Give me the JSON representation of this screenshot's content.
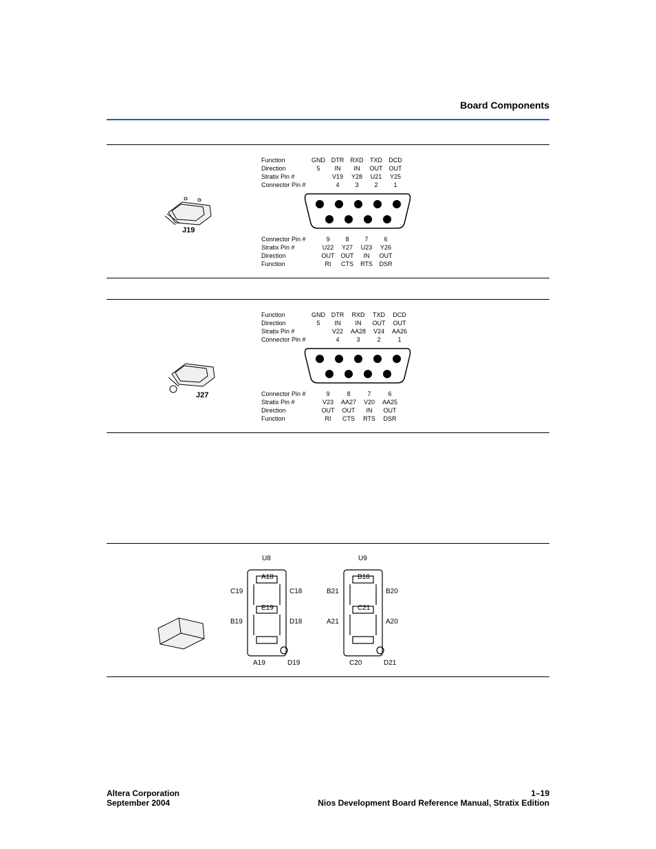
{
  "header": {
    "title": "Board Components"
  },
  "figure1": {
    "connector_label": "J19",
    "top": {
      "row_labels": [
        "Function",
        "Direction",
        "Stratix Pin #",
        "Connector Pin #"
      ],
      "cols": [
        {
          "function": "GND",
          "direction": "",
          "pin": "",
          "conn": "5"
        },
        {
          "function": "DTR",
          "direction": "IN",
          "pin": "V19",
          "conn": "4"
        },
        {
          "function": "RXD",
          "direction": "IN",
          "pin": "Y28",
          "conn": "3"
        },
        {
          "function": "TXD",
          "direction": "OUT",
          "pin": "U21",
          "conn": "2"
        },
        {
          "function": "DCD",
          "direction": "OUT",
          "pin": "Y25",
          "conn": "1"
        }
      ]
    },
    "bottom": {
      "row_labels": [
        "Connector Pin #",
        "Stratix Pin #",
        "Direction",
        "Function"
      ],
      "cols": [
        {
          "conn": "9",
          "pin": "U22",
          "direction": "OUT",
          "function": "RI"
        },
        {
          "conn": "8",
          "pin": "Y27",
          "direction": "OUT",
          "function": "CTS"
        },
        {
          "conn": "7",
          "pin": "U23",
          "direction": "IN",
          "function": "RTS"
        },
        {
          "conn": "6",
          "pin": "Y26",
          "direction": "OUT",
          "function": "DSR"
        }
      ]
    }
  },
  "figure2": {
    "connector_label": "J27",
    "top": {
      "row_labels": [
        "Function",
        "Direction",
        "Stratix Pin #",
        "Connector Pin #"
      ],
      "cols": [
        {
          "function": "GND",
          "direction": "",
          "pin": "",
          "conn": "5"
        },
        {
          "function": "DTR",
          "direction": "IN",
          "pin": "V22",
          "conn": "4"
        },
        {
          "function": "RXD",
          "direction": "IN",
          "pin": "AA28",
          "conn": "3"
        },
        {
          "function": "TXD",
          "direction": "OUT",
          "pin": "V24",
          "conn": "2"
        },
        {
          "function": "DCD",
          "direction": "OUT",
          "pin": "AA26",
          "conn": "1"
        }
      ]
    },
    "bottom": {
      "row_labels": [
        "Connector Pin #",
        "Stratix Pin #",
        "Direction",
        "Function"
      ],
      "cols": [
        {
          "conn": "9",
          "pin": "V23",
          "direction": "OUT",
          "function": "RI"
        },
        {
          "conn": "8",
          "pin": "AA27",
          "direction": "OUT",
          "function": "CTS"
        },
        {
          "conn": "7",
          "pin": "V20",
          "direction": "IN",
          "function": "RTS"
        },
        {
          "conn": "6",
          "pin": "AA25",
          "direction": "OUT",
          "function": "DSR"
        }
      ]
    }
  },
  "figure3": {
    "u8": {
      "name": "U8",
      "top": "A18",
      "mid": "E19",
      "left_top": "C19",
      "right_top": "C18",
      "left_bot": "B19",
      "right_bot": "D18",
      "bot_left": "A19",
      "bot_right": "D19"
    },
    "u9": {
      "name": "U9",
      "top": "B18",
      "mid": "C21",
      "left_top": "B21",
      "right_top": "B20",
      "left_bot": "A21",
      "right_bot": "A20",
      "bot_left": "C20",
      "bot_right": "D21"
    }
  },
  "footer": {
    "corp": "Altera Corporation",
    "date": "September 2004",
    "page": "1–19",
    "manual": "Nios Development Board Reference Manual, Stratix Edition"
  }
}
